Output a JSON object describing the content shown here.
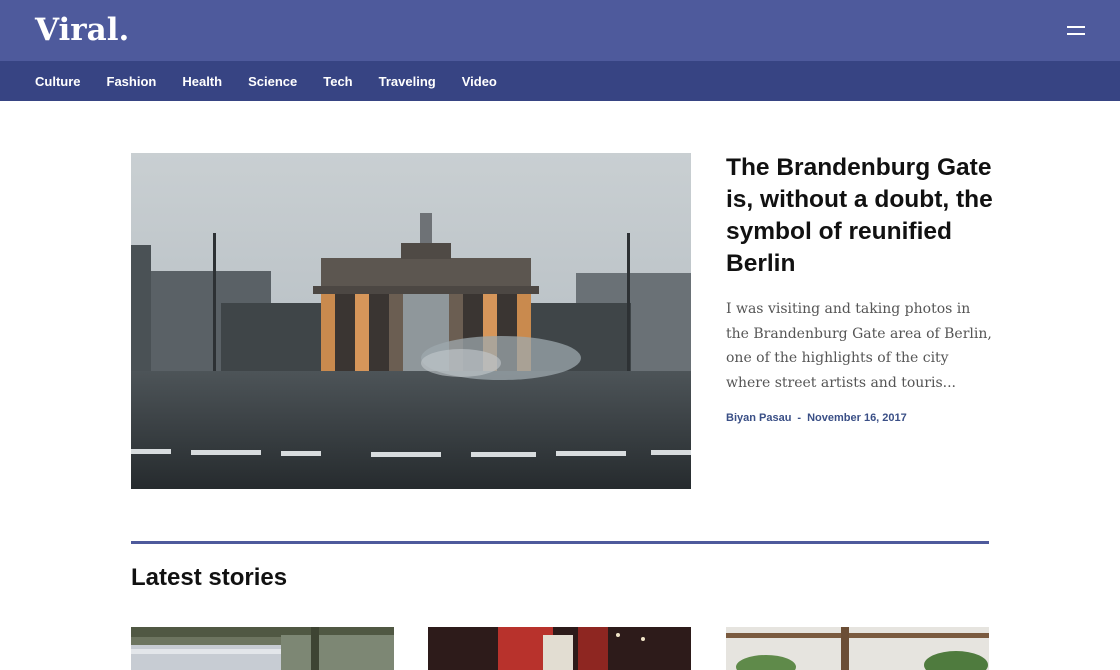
{
  "header": {
    "logo": "Viral.",
    "menu_icon": "hamburger-menu-icon"
  },
  "nav": {
    "items": [
      "Culture",
      "Fashion",
      "Health",
      "Science",
      "Tech",
      "Traveling",
      "Video"
    ]
  },
  "featured": {
    "title": "The Brandenburg Gate is, without a doubt, the symbol of reunified Berlin",
    "excerpt": "I was visiting and taking photos in the Brandenburg Gate area of Berlin, one of the highlights of the city where street artists and touris...",
    "author": "Biyan Pasau",
    "separator": "-",
    "date": "November 16, 2017"
  },
  "latest": {
    "title": "Latest stories"
  },
  "colors": {
    "topbar": "#4e5a9c",
    "navbar": "#374483",
    "meta_text": "#3a4f86",
    "accent_rule": "#4e5a9c"
  }
}
